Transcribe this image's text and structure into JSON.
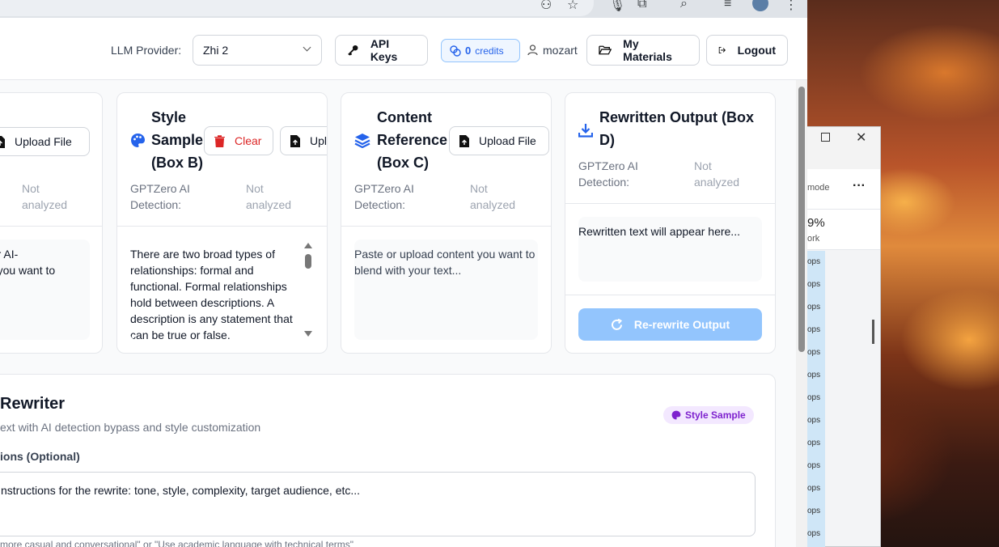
{
  "header": {
    "llm_label": "LLM Provider:",
    "llm_value": "Zhi 2",
    "api_keys": "API Keys",
    "credits_count": "0",
    "credits_label": "credits",
    "username": "mozart",
    "my_materials": "My Materials",
    "logout": "Logout"
  },
  "box_a": {
    "upload": "Upload File",
    "detection_value": "Not analyzed",
    "text": "our AI-\nat you want to"
  },
  "box_b": {
    "title": "Style Sample (Box B)",
    "clear": "Clear",
    "upload": "Uploa",
    "detection_label": "GPTZero AI Detection:",
    "detection_value": "Not analyzed",
    "text": "There are two broad types of relationships: formal and functional. Formal relationships hold between descriptions. A description is any statement that can be true or false."
  },
  "box_c": {
    "title": "Content Reference (Box C)",
    "upload": "Upload File",
    "detection_label": "GPTZero AI Detection:",
    "detection_value": "Not analyzed",
    "placeholder": "Paste or upload content you want to blend with your text..."
  },
  "box_d": {
    "title": "Rewritten Output (Box D)",
    "detection_label": "GPTZero AI Detection:",
    "detection_value": "Not analyzed",
    "placeholder": "Rewritten text will appear here...",
    "rerewrite": "Re-rewrite Output"
  },
  "rewriter": {
    "title": "Rewriter",
    "subtitle": "ext with AI detection bypass and style customization",
    "badge": "Style Sample",
    "instructions_label": "ions (Optional)",
    "instructions_placeholder": "nstructions for the rewrite: tone, style, complexity, target audience, etc...",
    "hint": "more casual and conversational\" or \"Use academic language with technical terms\""
  },
  "background_window": {
    "mode": "mode",
    "percent": "9%",
    "work": "ork",
    "list_item": "ops"
  },
  "colors": {
    "accent": "#2563eb",
    "disabled_button": "#93c5fd",
    "danger": "#dc2626",
    "badge_bg": "#f3e8ff",
    "badge_text": "#7e22ce"
  }
}
